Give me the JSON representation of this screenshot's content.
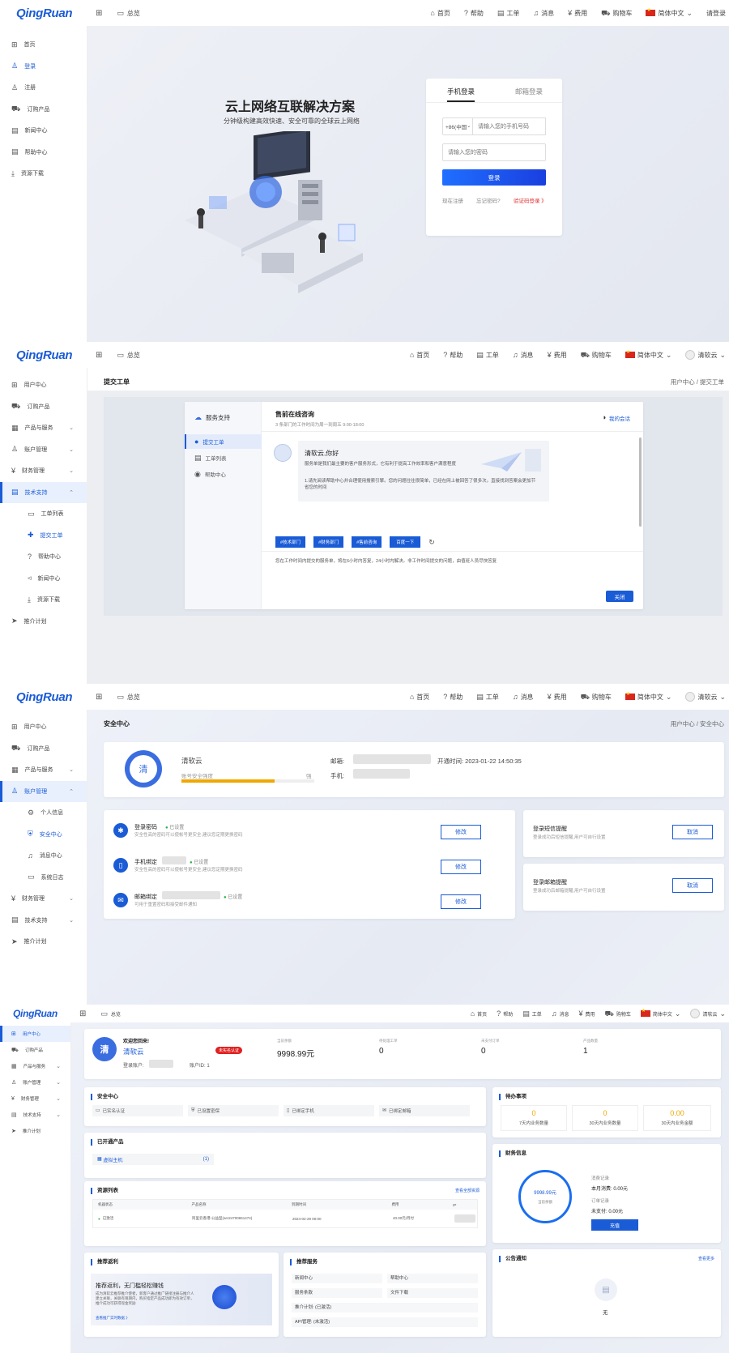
{
  "topbar": {
    "logo": "QingRuan",
    "overview": "总览",
    "home": "首页",
    "help": "帮助",
    "ticket": "工单",
    "message": "消息",
    "fee": "费用",
    "cart": "购物车",
    "lang": "简体中文",
    "login": "请登录",
    "user": "清软云"
  },
  "s1": {
    "sidebar": [
      "首页",
      "登录",
      "注册",
      "订购产品",
      "新闻中心",
      "帮助中心",
      "资源下载"
    ],
    "hero_title": "云上网络互联解决方案",
    "hero_sub": "分钟级构建高效快速、安全可靠的全球云上网络",
    "tab_phone": "手机登录",
    "tab_email": "邮箱登录",
    "country_code": "+86(中国",
    "phone_placeholder": "请输入您的手机号码",
    "pwd_placeholder": "请输入您的密码",
    "login_btn": "登录",
    "register": "现在注册",
    "forgot": "忘记密码?",
    "code_login": "验证码登录 》"
  },
  "s2": {
    "sidebar": [
      "用户中心",
      "订购产品",
      "产品与服务",
      "账户管理",
      "财务管理",
      "技术支持",
      "工单列表",
      "提交工单",
      "帮助中心",
      "新闻中心",
      "资源下载",
      "推介计划"
    ],
    "page_title": "提交工单",
    "breadcrumb": "用户中心 / 提交工单",
    "support_title": "服务支持",
    "menu": [
      "提交工单",
      "工单列表",
      "帮助中心"
    ],
    "chat_title": "售前在线咨询",
    "chat_sub": "3 条部门的工作时间为周一到周五 9:00-18:00",
    "my_session": "我的会话",
    "greet": "清软云,你好",
    "greet_sub": "服务单是我们最主要的客户服务形式，它有利于提高工作效率和客户满意程度",
    "tip": "1.请先阅读帮助中心并合理使用搜索引擎。您的问题往往很简单，已经在网上被回答了很多次。直接找到答案会更加节省您的时间",
    "tags": [
      "#技术部门",
      "#财务部门",
      "#售前咨询",
      "百度一下"
    ],
    "notice": "您在工作时间内提交的服务单，将在6小时内答复，24小时内解决。非工作时间提交的问题，由值班人员尽快答复",
    "close_btn": "关闭"
  },
  "s3": {
    "sidebar": [
      "用户中心",
      "订购产品",
      "产品与服务",
      "账户管理",
      "个人信息",
      "安全中心",
      "消息中心",
      "系统日志",
      "财务管理",
      "技术支持",
      "推介计划"
    ],
    "page_title": "安全中心",
    "breadcrumb": "用户中心 / 安全中心",
    "avatar_char": "清",
    "name": "清软云",
    "strength_label": "账号安全强度",
    "strength_value": "强",
    "strength_pct": 0.7,
    "email_label": "邮箱:",
    "phone_label": "手机:",
    "open_time": "开通时间: 2023-01-22 14:50:35",
    "items": [
      {
        "title": "登录密码",
        "status": "已设置",
        "desc": "安全性高的密码可以使帐号更安全,建议您定期更换密码",
        "btn": "修改"
      },
      {
        "title": "手机绑定",
        "status": "已设置",
        "desc": "安全性高的密码可以使帐号更安全,建议您定期更换密码",
        "btn": "修改"
      },
      {
        "title": "邮箱绑定",
        "status": "已设置",
        "desc": "可用于重置密码和接受邮件通知",
        "btn": "修改"
      }
    ],
    "sms_title": "登录短信提醒",
    "sms_desc": "登录成功后短信提醒,用户可自行设置",
    "mail_title": "登录邮箱提醒",
    "mail_desc": "登录成功后邮箱提醒,用户可自行设置",
    "cancel": "取消"
  },
  "s4": {
    "sidebar": [
      "用户中心",
      "订购产品",
      "产品与服务",
      "账户管理",
      "财务管理",
      "技术支持",
      "推介计划"
    ],
    "welcome": "欢迎您回来!",
    "name": "清软云",
    "badge": "未实名认证",
    "login_acct": "登录账户:",
    "acct_id": "账户ID: 1",
    "stats": [
      {
        "label": "当前余额",
        "value": "9998.99元"
      },
      {
        "label": "待处理工单",
        "value": "0"
      },
      {
        "label": "未支付订单",
        "value": "0"
      },
      {
        "label": "产品数量",
        "value": "1"
      }
    ],
    "security_title": "安全中心",
    "security_items": [
      "已实名认证",
      "已设置密保",
      "已绑定手机",
      "已绑定邮箱"
    ],
    "todo_title": "待办事项",
    "todo": [
      {
        "value": "0",
        "label": "7天内业务数量"
      },
      {
        "value": "0",
        "label": "30天内业务数量"
      },
      {
        "value": "0.00",
        "label": "30天内业务金额"
      }
    ],
    "opened_title": "已开通产品",
    "opened_item": "虚拟主机",
    "opened_count": "(1)",
    "finance_title": "财务信息",
    "ring_value": "9998.99元",
    "ring_label": "当前余额",
    "consume_label": "消费记录",
    "month_consume": "本月消费: 0.00元",
    "order_label": "订单记录",
    "unpaid": "未支付: 0.00元",
    "recharge": "充值",
    "resources_title": "资源列表",
    "view_all": "查看全部资源",
    "res_headers": [
      "机器状态",
      "产品名称",
      "到期时间",
      "费用",
      "IP"
    ],
    "res_row": [
      "已激活",
      "阿里云香港-公益型(ser24700651474)",
      "2024-02-29 00:00",
      "40.00元/月付",
      ""
    ],
    "promo_title": "推荐返利",
    "promo_head": "推荐返利，无门槛轻松赚钱",
    "promo_text": "成为清软云推荐推介使者，新客户通过推广链接注册与推介人建立关联，关联有限期内，购买指定产品成功即为有效订单，推介成功可获得现金奖励",
    "promo_link": "查看推广实时数据 》",
    "svc_title": "推荐服务",
    "svc": [
      "新闻中心",
      "帮助中心",
      "服务条款",
      "文件下载",
      "推介计划: (已激活)",
      "API管理: (未激活)"
    ],
    "notice_title": "公告通知",
    "notice_more": "查看更多",
    "notice_empty": "无"
  }
}
